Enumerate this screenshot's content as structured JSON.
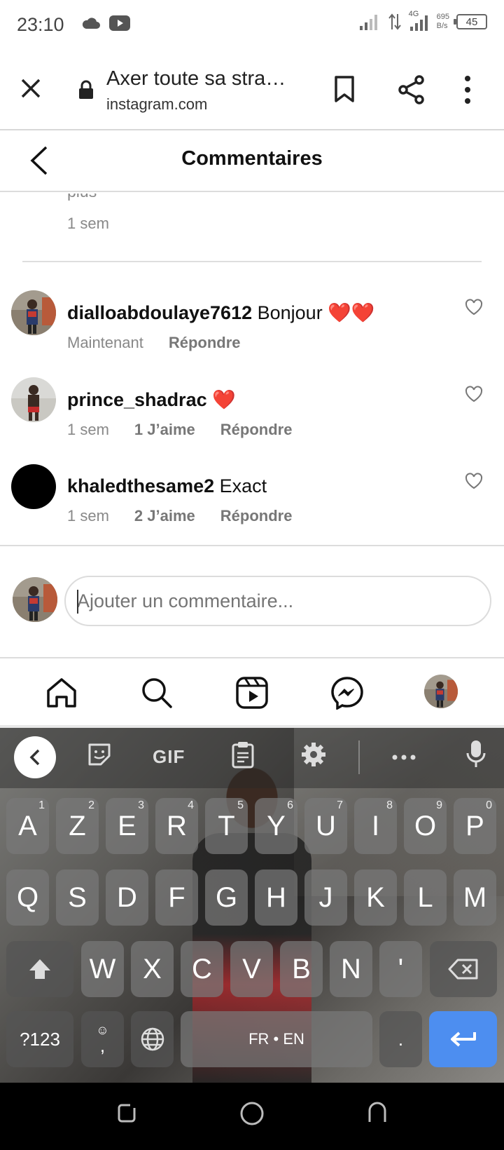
{
  "status_bar": {
    "time": "23:10",
    "network_type": "4G",
    "net_speed_value": "695",
    "net_speed_unit": "B/s",
    "battery": "45"
  },
  "browser": {
    "page_title": "Axer toute sa stra…",
    "domain": "instagram.com"
  },
  "header": {
    "title": "Commentaires"
  },
  "previous_comment": {
    "text_fragment": "plus",
    "time": "1 sem"
  },
  "comments": [
    {
      "username": "dialloabdoulaye7612",
      "text": "Bonjour ❤️❤️",
      "time": "Maintenant",
      "likes": "",
      "reply": "Répondre"
    },
    {
      "username": "prince_shadrac",
      "text": "❤️",
      "time": "1 sem",
      "likes": "1 J’aime",
      "reply": "Répondre"
    },
    {
      "username": "khaledthesame2",
      "text": "Exact",
      "time": "1 sem",
      "likes": "2 J’aime",
      "reply": "Répondre"
    }
  ],
  "add_comment": {
    "placeholder": "Ajouter un commentaire..."
  },
  "keyboard": {
    "toolbar": {
      "gif_label": "GIF"
    },
    "row1": [
      {
        "k": "A",
        "h": "1"
      },
      {
        "k": "Z",
        "h": "2"
      },
      {
        "k": "E",
        "h": "3"
      },
      {
        "k": "R",
        "h": "4"
      },
      {
        "k": "T",
        "h": "5"
      },
      {
        "k": "Y",
        "h": "6"
      },
      {
        "k": "U",
        "h": "7"
      },
      {
        "k": "I",
        "h": "8"
      },
      {
        "k": "O",
        "h": "9"
      },
      {
        "k": "P",
        "h": "0"
      }
    ],
    "row2": [
      "Q",
      "S",
      "D",
      "F",
      "G",
      "H",
      "J",
      "K",
      "L",
      "M"
    ],
    "row3": [
      "W",
      "X",
      "C",
      "V",
      "B",
      "N",
      "'"
    ],
    "symbols_label": "?123",
    "comma_label": ",",
    "space_label": "FR • EN",
    "period_label": "."
  },
  "colors": {
    "heart_red": "#e8212f",
    "enter_blue": "#4d8ef0"
  }
}
